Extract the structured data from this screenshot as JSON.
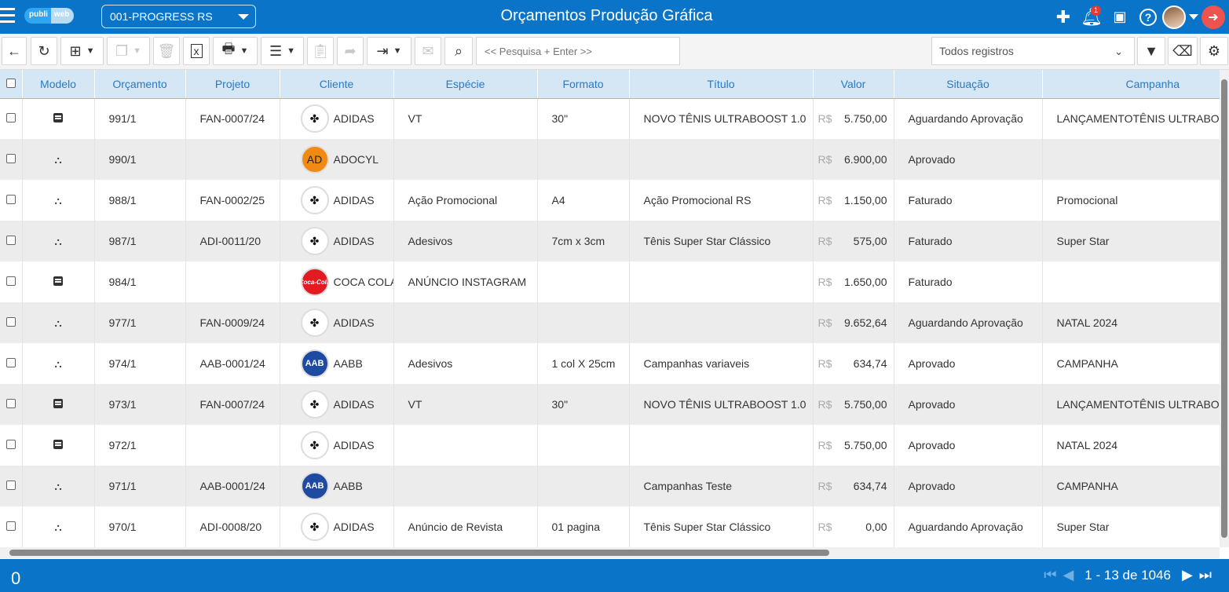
{
  "header": {
    "logo_left": "publi",
    "logo_right": "web",
    "company": "001-PROGRESS RS",
    "title": "Orçamentos Produção Gráfica",
    "notifications_count": "1"
  },
  "toolbar": {
    "search_placeholder": "<< Pesquisa + Enter >>",
    "filter_value": "Todos registros"
  },
  "table": {
    "columns": [
      "Modelo",
      "Orçamento",
      "Projeto",
      "Cliente",
      "Espécie",
      "Formato",
      "Título",
      "Valor",
      "Situação",
      "Campanha"
    ],
    "currency": "R$",
    "rows": [
      {
        "modelo": "doc",
        "orcamento": "991/1",
        "projeto": "FAN-0007/24",
        "cliente": "ADIDAS",
        "logo": "adidas",
        "especie": "VT",
        "formato": "30\"",
        "titulo": "NOVO TÊNIS ULTRABOOST 1.0",
        "valor": "5.750,00",
        "situacao": "Aguardando Aprovação",
        "campanha": "LANÇAMENTOTÊNIS ULTRABOC"
      },
      {
        "modelo": "org",
        "orcamento": "990/1",
        "projeto": "",
        "cliente": "ADOCYL",
        "logo": "adocyl",
        "especie": "",
        "formato": "",
        "titulo": "",
        "valor": "6.900,00",
        "situacao": "Aprovado",
        "campanha": ""
      },
      {
        "modelo": "org",
        "orcamento": "988/1",
        "projeto": "FAN-0002/25",
        "cliente": "ADIDAS",
        "logo": "adidas",
        "especie": "Ação Promocional",
        "formato": "A4",
        "titulo": "Ação Promocional RS",
        "valor": "1.150,00",
        "situacao": "Faturado",
        "campanha": "Promocional"
      },
      {
        "modelo": "org",
        "orcamento": "987/1",
        "projeto": "ADI-0011/20",
        "cliente": "ADIDAS",
        "logo": "adidas",
        "especie": "Adesivos",
        "formato": "7cm x 3cm",
        "titulo": "Tênis Super Star Clássico",
        "valor": "575,00",
        "situacao": "Faturado",
        "campanha": "Super Star"
      },
      {
        "modelo": "doc",
        "orcamento": "984/1",
        "projeto": "",
        "cliente": "COCA COLA",
        "logo": "coca",
        "especie": "ANÚNCIO INSTAGRAM",
        "formato": "",
        "titulo": "",
        "valor": "1.650,00",
        "situacao": "Faturado",
        "campanha": ""
      },
      {
        "modelo": "org",
        "orcamento": "977/1",
        "projeto": "FAN-0009/24",
        "cliente": "ADIDAS",
        "logo": "adidas",
        "especie": "",
        "formato": "",
        "titulo": "",
        "valor": "9.652,64",
        "situacao": "Aguardando Aprovação",
        "campanha": "NATAL 2024"
      },
      {
        "modelo": "org",
        "orcamento": "974/1",
        "projeto": "AAB-0001/24",
        "cliente": "AABB",
        "logo": "aabb",
        "especie": "Adesivos",
        "formato": "1 col X 25cm",
        "titulo": "Campanhas variaveis",
        "valor": "634,74",
        "situacao": "Aprovado",
        "campanha": "CAMPANHA"
      },
      {
        "modelo": "doc",
        "orcamento": "973/1",
        "projeto": "FAN-0007/24",
        "cliente": "ADIDAS",
        "logo": "adidas",
        "especie": "VT",
        "formato": "30\"",
        "titulo": "NOVO TÊNIS ULTRABOOST 1.0",
        "valor": "5.750,00",
        "situacao": "Aprovado",
        "campanha": "LANÇAMENTOTÊNIS ULTRABOC"
      },
      {
        "modelo": "doc",
        "orcamento": "972/1",
        "projeto": "",
        "cliente": "ADIDAS",
        "logo": "adidas",
        "especie": "",
        "formato": "",
        "titulo": "",
        "valor": "5.750,00",
        "situacao": "Aprovado",
        "campanha": "NATAL 2024"
      },
      {
        "modelo": "org",
        "orcamento": "971/1",
        "projeto": "AAB-0001/24",
        "cliente": "AABB",
        "logo": "aabb",
        "especie": "",
        "formato": "",
        "titulo": "Campanhas Teste",
        "valor": "634,74",
        "situacao": "Aprovado",
        "campanha": "CAMPANHA"
      },
      {
        "modelo": "org",
        "orcamento": "970/1",
        "projeto": "ADI-0008/20",
        "cliente": "ADIDAS",
        "logo": "adidas",
        "especie": "Anúncio de Revista",
        "formato": "01 pagina",
        "titulo": "Tênis Super Star Clássico",
        "valor": "0,00",
        "situacao": "Aguardando Aprovação",
        "campanha": "Super Star"
      }
    ]
  },
  "logo_text": {
    "adidas": "✤",
    "adocyl": "AD",
    "coca": "Coca-Cola",
    "aabb": "AAB"
  },
  "footer": {
    "count": "0",
    "range": "1 - 13 de 1046"
  }
}
